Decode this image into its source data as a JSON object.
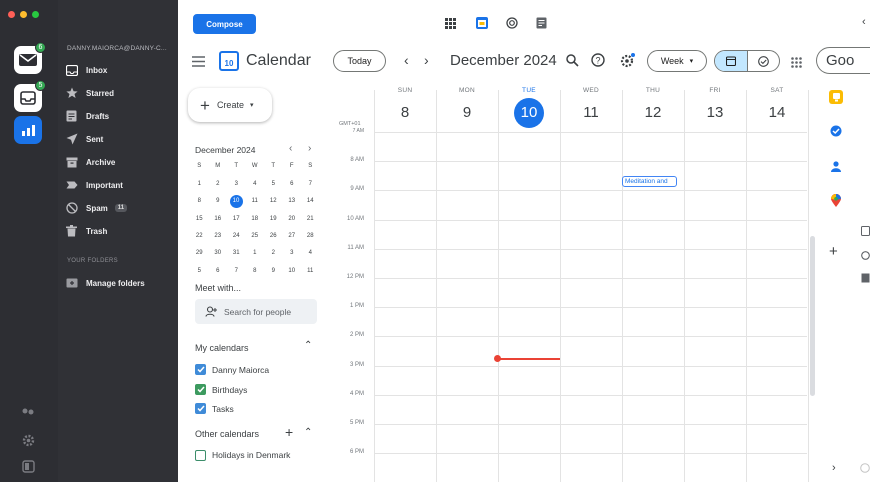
{
  "mail": {
    "account_email": "DANNY.MAIORCA@DANNY-C...",
    "account_badges": [
      "6",
      "5"
    ],
    "folders": [
      {
        "label": "Inbox",
        "icon": "inbox-icon"
      },
      {
        "label": "Starred",
        "icon": "star-icon"
      },
      {
        "label": "Drafts",
        "icon": "drafts-icon"
      },
      {
        "label": "Sent",
        "icon": "sent-icon"
      },
      {
        "label": "Archive",
        "icon": "archive-icon"
      },
      {
        "label": "Important",
        "icon": "important-icon"
      },
      {
        "label": "Spam",
        "icon": "spam-icon",
        "count": "11"
      },
      {
        "label": "Trash",
        "icon": "trash-icon"
      }
    ],
    "your_folders_heading": "YOUR FOLDERS",
    "manage_folders": "Manage folders",
    "compose_label": "Compose"
  },
  "calendar": {
    "app_title": "Calendar",
    "logo_day": "10",
    "today_label": "Today",
    "month_title": "December 2024",
    "view_label": "Week",
    "google_partial": "Goo",
    "create_label": "Create",
    "mini_month": "December 2024",
    "mini_dow": [
      "S",
      "M",
      "T",
      "W",
      "T",
      "F",
      "S"
    ],
    "mini_weeks": [
      [
        "1",
        "2",
        "3",
        "4",
        "5",
        "6",
        "7"
      ],
      [
        "8",
        "9",
        "10",
        "11",
        "12",
        "13",
        "14"
      ],
      [
        "15",
        "16",
        "17",
        "18",
        "19",
        "20",
        "21"
      ],
      [
        "22",
        "23",
        "24",
        "25",
        "26",
        "27",
        "28"
      ],
      [
        "29",
        "30",
        "31",
        "1",
        "2",
        "3",
        "4"
      ],
      [
        "5",
        "6",
        "7",
        "8",
        "9",
        "10",
        "11"
      ]
    ],
    "meet_with": "Meet with...",
    "search_people": "Search for people",
    "my_calendars_heading": "My calendars",
    "my_calendars": [
      "Danny Maiorca",
      "Birthdays",
      "Tasks"
    ],
    "other_calendars_heading": "Other calendars",
    "other_calendars": [
      "Holidays in Denmark"
    ],
    "timezone": "GMT+01",
    "days": [
      {
        "name": "SUN",
        "num": "8"
      },
      {
        "name": "MON",
        "num": "9"
      },
      {
        "name": "TUE",
        "num": "10",
        "today": true
      },
      {
        "name": "WED",
        "num": "11"
      },
      {
        "name": "THU",
        "num": "12"
      },
      {
        "name": "FRI",
        "num": "13"
      },
      {
        "name": "SAT",
        "num": "14"
      }
    ],
    "times": [
      "7 AM",
      "8 AM",
      "9 AM",
      "10 AM",
      "11 AM",
      "12 PM",
      "1 PM",
      "2 PM",
      "3 PM",
      "4 PM",
      "5 PM",
      "6 PM"
    ],
    "event_label": "Meditation and",
    "colors": {
      "accent": "#1a73e8",
      "now_line": "#ea4335",
      "event_border": "#4285f4"
    }
  }
}
